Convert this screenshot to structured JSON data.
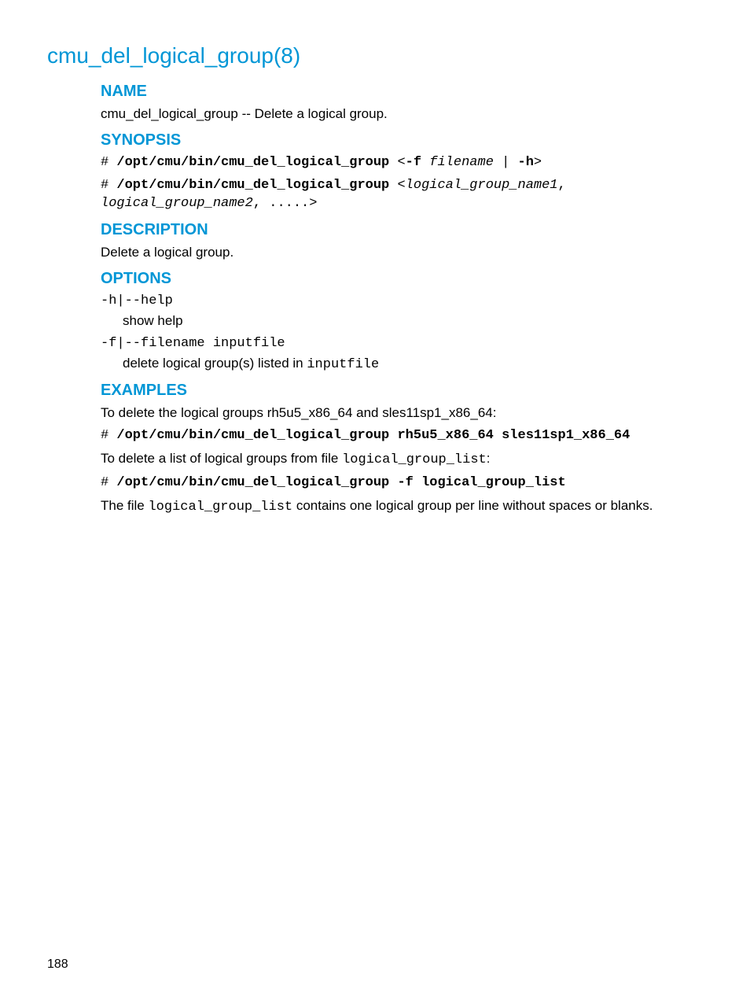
{
  "title": "cmu_del_logical_group(8)",
  "page_number": "188",
  "sections": {
    "name": {
      "heading": "NAME",
      "text": "cmu_del_logical_group -- Delete a logical group."
    },
    "synopsis": {
      "heading": "SYNOPSIS",
      "line1_prefix": "# ",
      "line1_cmd": "/opt/cmu/bin/cmu_del_logical_group",
      "line1_mid": " <",
      "line1_flag": "-f",
      "line1_space": " ",
      "line1_arg": "filename",
      "line1_pipe": " | ",
      "line1_h": "-h",
      "line1_end": ">",
      "line2_prefix": "# ",
      "line2_cmd": "/opt/cmu/bin/cmu_del_logical_group",
      "line2_mid": " <",
      "line2_arg1": "logical_group_name1",
      "line2_comma": ",",
      "line2_arg2": "logical_group_name2",
      "line2_dots": ", .....>"
    },
    "description": {
      "heading": "DESCRIPTION",
      "text": "Delete a logical group."
    },
    "options": {
      "heading": "OPTIONS",
      "opt1_flag": "-h|--help",
      "opt1_desc": "show help",
      "opt2_flag": "-f|--filename inputfile",
      "opt2_desc_pre": "delete logical group(s) listed in ",
      "opt2_desc_mono": "inputfile"
    },
    "examples": {
      "heading": "EXAMPLES",
      "intro1": "To delete the logical groups rh5u5_x86_64 and sles11sp1_x86_64:",
      "cmd1_prefix": "# ",
      "cmd1": "/opt/cmu/bin/cmu_del_logical_group rh5u5_x86_64 sles11sp1_x86_64",
      "intro2_pre": "To delete a list of logical groups from file ",
      "intro2_mono": "logical_group_list",
      "intro2_post": ":",
      "cmd2_prefix": "# ",
      "cmd2": "/opt/cmu/bin/cmu_del_logical_group -f logical_group_list",
      "note_pre": "The file ",
      "note_mono": "logical_group_list",
      "note_post": " contains one logical group per line without spaces or blanks."
    }
  }
}
